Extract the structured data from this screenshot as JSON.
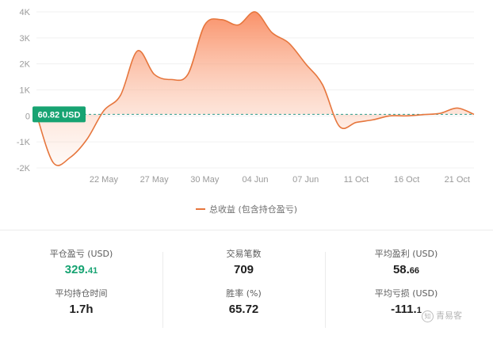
{
  "chart_data": {
    "type": "area",
    "series": [
      {
        "name": "总收益 (包含持仓盈亏)",
        "x": [
          "",
          "",
          "",
          "",
          "22 May",
          "",
          "",
          "27 May",
          "",
          "",
          "30 May",
          "",
          "",
          "04 Jun",
          "",
          "",
          "07 Jun",
          "",
          "",
          "11 Oct",
          "",
          "",
          "16 Oct",
          "",
          "",
          "21 Oct",
          ""
        ],
        "values": [
          0.06,
          -1.8,
          -1.6,
          -0.9,
          0.2,
          0.8,
          2.5,
          1.6,
          1.4,
          1.6,
          3.5,
          3.7,
          3.5,
          4.0,
          3.2,
          2.8,
          2.0,
          1.2,
          -0.4,
          -0.25,
          -0.15,
          0.0,
          0.0,
          0.05,
          0.1,
          0.3,
          0.06
        ]
      }
    ],
    "xticks": [
      "22 May",
      "27 May",
      "30 May",
      "04 Jun",
      "07 Jun",
      "11 Oct",
      "16 Oct",
      "21 Oct"
    ],
    "yticks": [
      "4K",
      "3K",
      "2K",
      "1K",
      "0",
      "-1K",
      "-2K"
    ],
    "ylim": [
      -2,
      4
    ],
    "current_value_label": "60.82 USD",
    "grid": "horizontal",
    "legend_position": "bottom-center",
    "colors": {
      "line": "#e6763d",
      "fill_top": "#f98b60",
      "baseline": "#2c9c8c",
      "badge": "#17a372"
    }
  },
  "legend": {
    "label": "总收益 (包含持仓盈亏)"
  },
  "stats": {
    "col1": {
      "r1": {
        "label": "平仓盈亏 (USD)",
        "int": "329.",
        "frac": "41"
      },
      "r2": {
        "label": "平均持仓时间",
        "value": "1.7h"
      }
    },
    "col2": {
      "r1": {
        "label": "交易笔数",
        "value": "709"
      },
      "r2": {
        "label": "胜率 (%)",
        "value": "65.72"
      }
    },
    "col3": {
      "r1": {
        "label": "平均盈利 (USD)",
        "int": "58.",
        "frac": "66"
      },
      "r2": {
        "label": "平均亏损 (USD)",
        "int": "-111.",
        "frac": "1"
      }
    }
  },
  "watermark": {
    "logo_glyph": "知",
    "text": "青易客"
  }
}
